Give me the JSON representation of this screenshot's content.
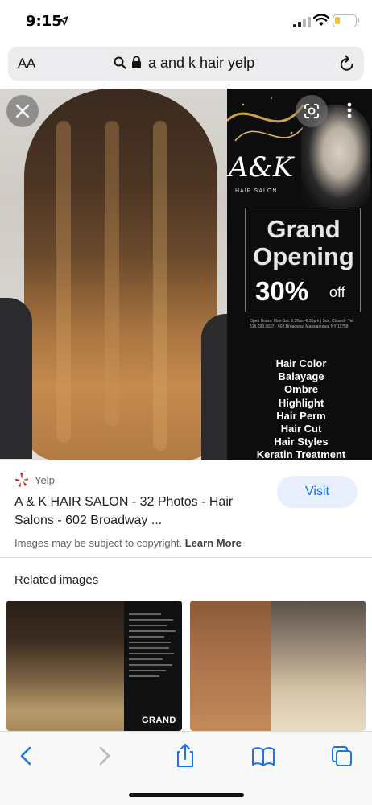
{
  "status_bar": {
    "time": "9:15",
    "battery_level": 0.25,
    "battery_color": "#f2c12e"
  },
  "browser": {
    "text_size_label": "AA",
    "url_text": "a and k hair yelp"
  },
  "hero": {
    "salon_logo": "A&K",
    "salon_sublabel": "HAIR SALON",
    "promo_line1": "Grand",
    "promo_line2": "Opening",
    "promo_discount": "30%",
    "promo_off": "off",
    "fine_print": "Open Hours: Mon-Sat. 9:30am-6:30pm | Sun. Closed · Tel: 516.299.9637 · 602 Broadway, Massapequa, NY 11758",
    "services": [
      "Hair Color",
      "Balayage",
      "Ombre",
      "Highlight",
      "Hair Perm",
      "Hair Cut",
      "Hair Styles",
      "Keratin Treatment"
    ]
  },
  "result": {
    "source": "Yelp",
    "title": "A & K HAIR SALON - 32 Photos - Hair Salons - 602 Broadway ...",
    "visit_label": "Visit",
    "copyright_text": "Images may be subject to copyright.",
    "learn_more": "Learn More"
  },
  "related": {
    "heading": "Related images",
    "thumb1_label": "GRAND"
  },
  "icons": {
    "close": "close-icon",
    "lens": "lens-icon",
    "more": "more-vert-icon",
    "back": "back-icon",
    "forward": "forward-icon",
    "share": "share-icon",
    "bookmarks": "bookmarks-icon",
    "tabs": "tabs-icon"
  },
  "colors": {
    "accent": "#1a73e8",
    "visit_bg": "#e8f0fe",
    "yelp_red": "#d32323"
  }
}
